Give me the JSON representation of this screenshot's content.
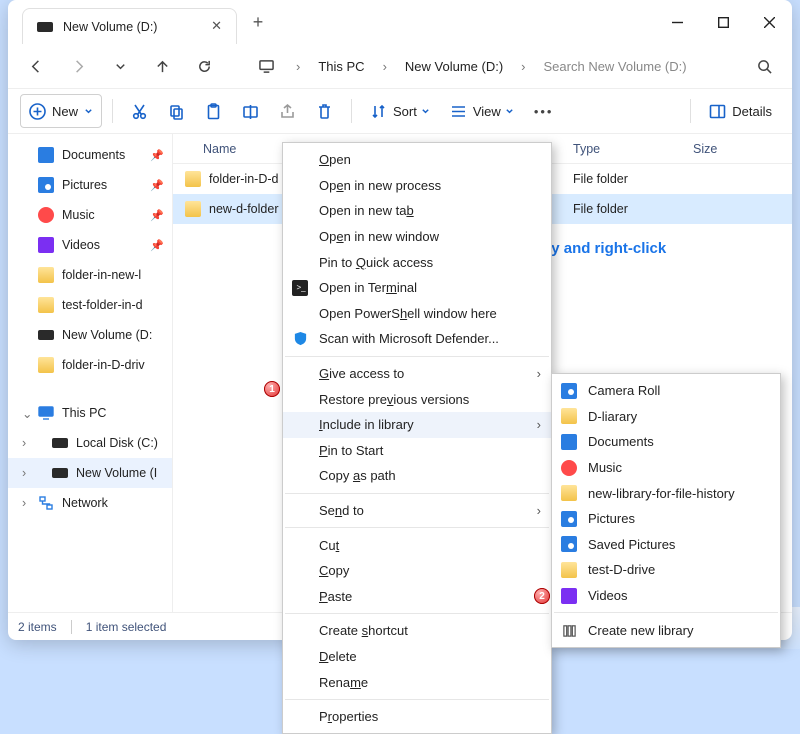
{
  "tab_title": "New Volume (D:)",
  "breadcrumb": {
    "pc": "This PC",
    "vol": "New Volume (D:)"
  },
  "search_placeholder": "Search New Volume (D:)",
  "toolbar": {
    "new": "New",
    "sort": "Sort",
    "view": "View",
    "details": "Details"
  },
  "sidebar": {
    "quick": [
      {
        "label": "Documents",
        "icon": "doc",
        "pin": true
      },
      {
        "label": "Pictures",
        "icon": "pic",
        "pin": true
      },
      {
        "label": "Music",
        "icon": "music",
        "pin": true
      },
      {
        "label": "Videos",
        "icon": "video",
        "pin": true
      },
      {
        "label": "folder-in-new-l",
        "icon": "folder"
      },
      {
        "label": "test-folder-in-d",
        "icon": "folder"
      },
      {
        "label": "New Volume (D:",
        "icon": "drive"
      },
      {
        "label": "folder-in-D-driv",
        "icon": "folder"
      }
    ],
    "thispc": "This PC",
    "drives": [
      {
        "label": "Local Disk (C:)"
      },
      {
        "label": "New Volume (I"
      }
    ],
    "network": "Network"
  },
  "columns": {
    "name": "Name",
    "date": "",
    "type": "Type",
    "size": "Size"
  },
  "rows": [
    {
      "name": "folder-in-D-d",
      "type": "File folder",
      "selected": false
    },
    {
      "name": "new-d-folder",
      "type": "File folder",
      "selected": true
    }
  ],
  "status": {
    "items": "2 items",
    "selected": "1 item selected"
  },
  "annotation": "Press Shift key and right-click",
  "context_menu": [
    {
      "type": "item",
      "pre": "",
      "u": "O",
      "post": "pen"
    },
    {
      "type": "item",
      "pre": "Op",
      "u": "e",
      "post": "n in new process"
    },
    {
      "type": "item",
      "pre": "Open in new ta",
      "u": "b",
      "post": ""
    },
    {
      "type": "item",
      "pre": "Op",
      "u": "e",
      "post": "n in new window"
    },
    {
      "type": "item",
      "pre": "Pin to ",
      "u": "Q",
      "post": "uick access"
    },
    {
      "type": "item",
      "pre": "Open in Ter",
      "u": "m",
      "post": "inal",
      "icon": "terminal"
    },
    {
      "type": "item",
      "pre": "Open PowerS",
      "u": "h",
      "post": "ell window here"
    },
    {
      "type": "item",
      "pre": "Scan with Microsoft Defender...",
      "icon": "shield"
    },
    {
      "type": "div"
    },
    {
      "type": "item",
      "pre": "",
      "u": "G",
      "post": "ive access to",
      "submenu": true
    },
    {
      "type": "item",
      "pre": "Restore pre",
      "u": "v",
      "post": "ious versions"
    },
    {
      "type": "item",
      "pre": "",
      "u": "I",
      "post": "nclude in library",
      "submenu": true,
      "hover": true,
      "badge": "1"
    },
    {
      "type": "item",
      "pre": "",
      "u": "P",
      "post": "in to Start"
    },
    {
      "type": "item",
      "pre": "Copy ",
      "u": "a",
      "post": "s path"
    },
    {
      "type": "div"
    },
    {
      "type": "item",
      "pre": "Se",
      "u": "n",
      "post": "d to",
      "submenu": true
    },
    {
      "type": "div"
    },
    {
      "type": "item",
      "pre": "Cu",
      "u": "t",
      "post": ""
    },
    {
      "type": "item",
      "pre": "",
      "u": "C",
      "post": "opy"
    },
    {
      "type": "item",
      "pre": "",
      "u": "P",
      "post": "aste"
    },
    {
      "type": "div"
    },
    {
      "type": "item",
      "pre": "Create ",
      "u": "s",
      "post": "hortcut"
    },
    {
      "type": "item",
      "pre": "",
      "u": "D",
      "post": "elete"
    },
    {
      "type": "item",
      "pre": "Rena",
      "u": "m",
      "post": "e"
    },
    {
      "type": "div"
    },
    {
      "type": "item",
      "pre": "P",
      "u": "r",
      "post": "operties"
    }
  ],
  "library_menu": [
    {
      "label": "Camera Roll",
      "icon": "pic"
    },
    {
      "label": "D-liarary",
      "icon": "folder"
    },
    {
      "label": "Documents",
      "icon": "doc"
    },
    {
      "label": "Music",
      "icon": "music"
    },
    {
      "label": "new-library-for-file-history",
      "icon": "folder"
    },
    {
      "label": "Pictures",
      "icon": "pic"
    },
    {
      "label": "Saved Pictures",
      "icon": "pic"
    },
    {
      "label": "test-D-drive",
      "icon": "folder"
    },
    {
      "label": "Videos",
      "icon": "video"
    }
  ],
  "library_create": "Create new library"
}
